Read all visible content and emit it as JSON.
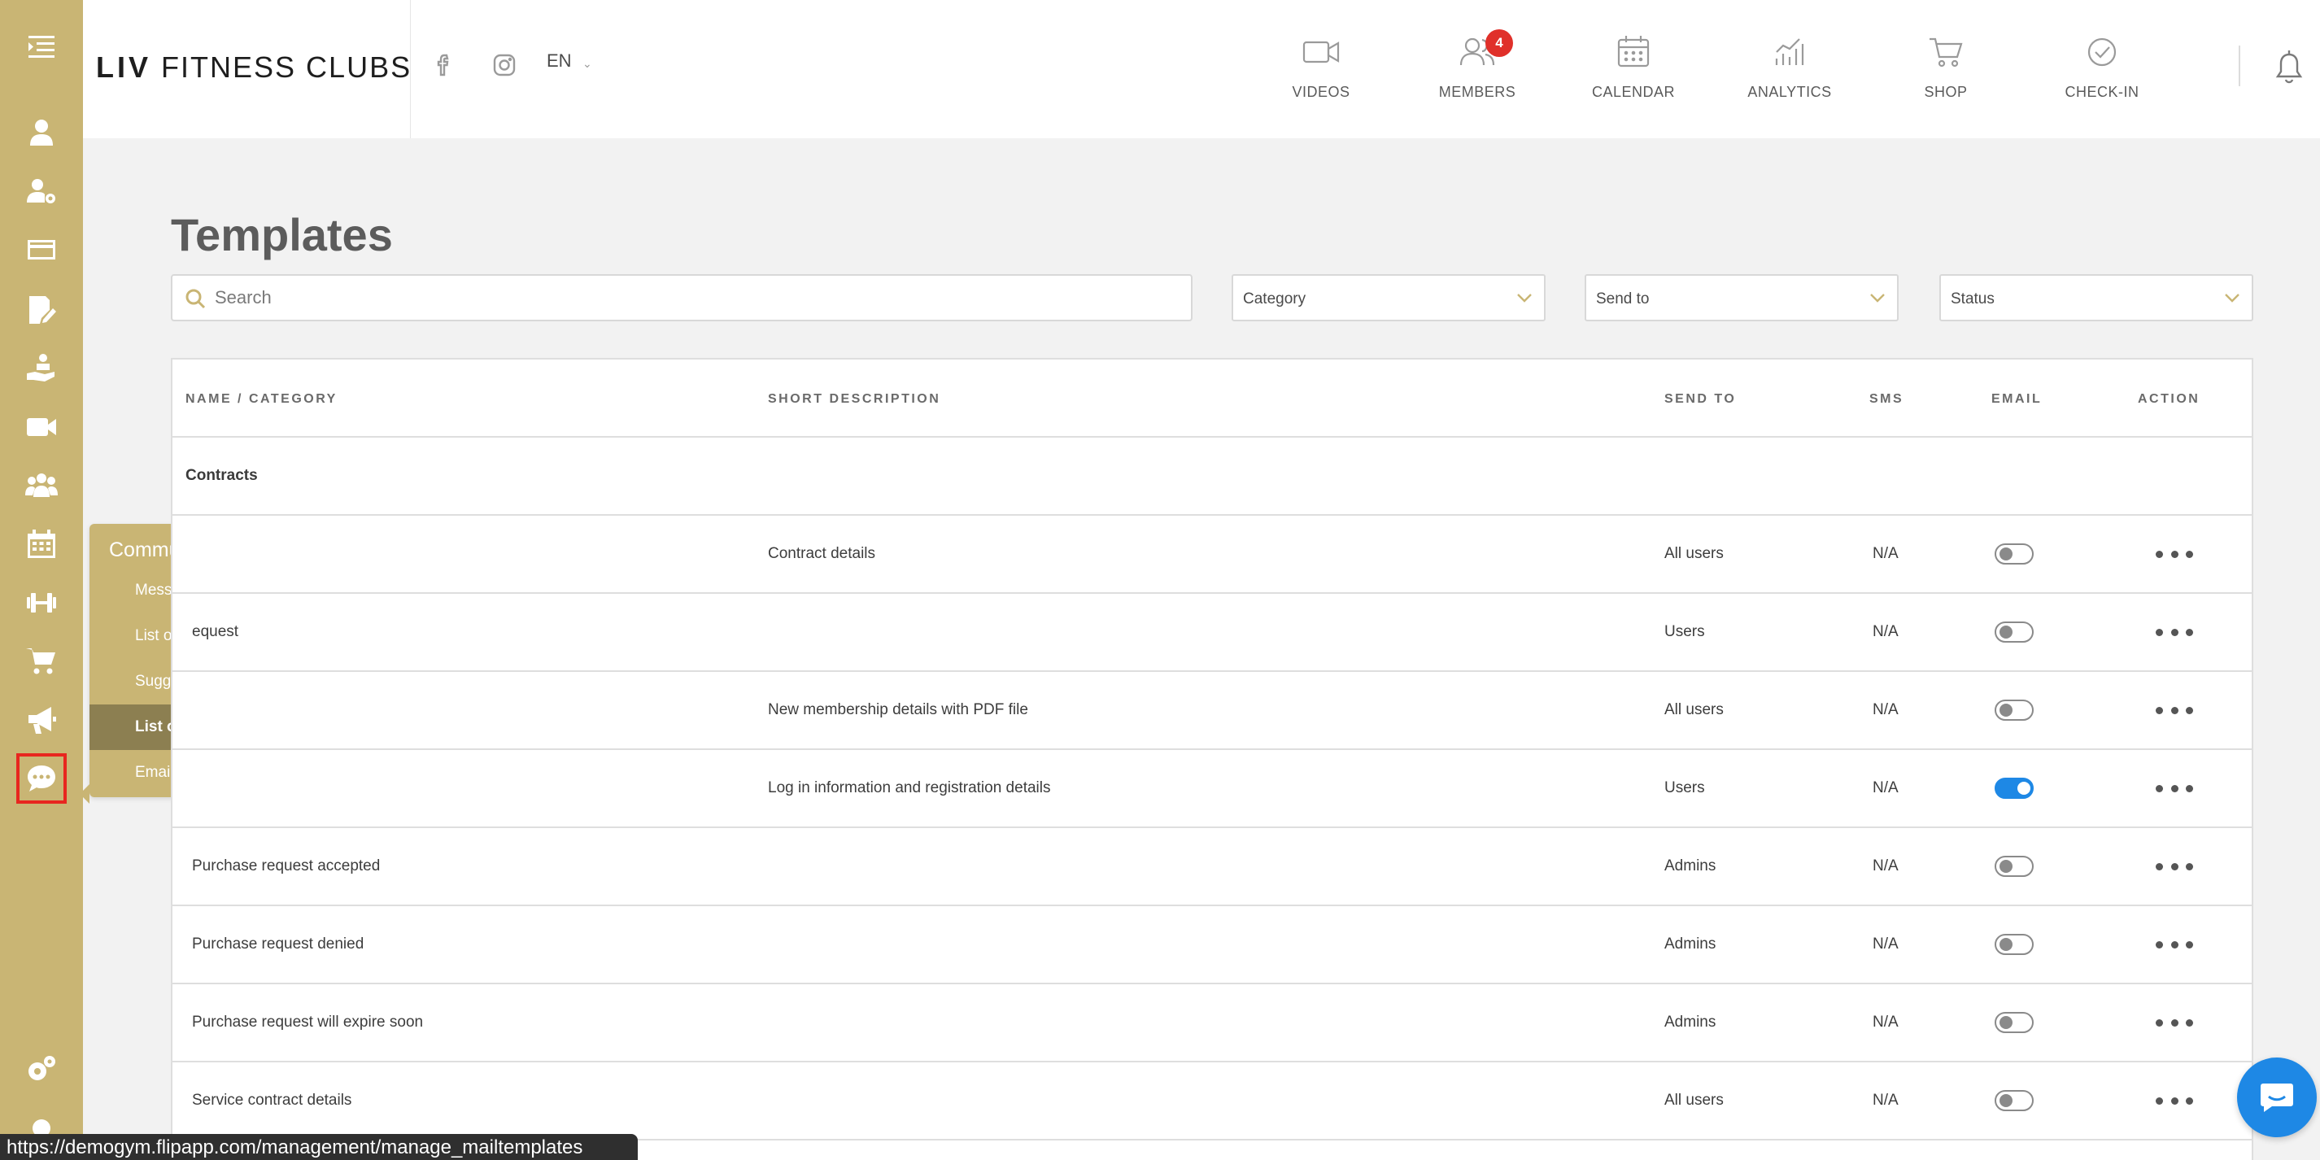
{
  "sidebar": {
    "icons": [
      "collapse-menu-icon",
      "user-icon",
      "user-settings-icon",
      "credit-card-icon",
      "document-edit-icon",
      "hand-service-icon",
      "video-icon",
      "group-icon",
      "calendar-icon",
      "dumbbell-icon",
      "cart-icon",
      "megaphone-icon",
      "chat-bubble-icon",
      "settings-icon"
    ],
    "active": "chat-bubble-icon"
  },
  "flyout": {
    "title": "Communications",
    "items": [
      "Messages",
      "List of quotes",
      "Suggestions",
      "List of templates",
      "Emails"
    ],
    "selected": "List of templates"
  },
  "header": {
    "logo_bold": "LIV",
    "logo_rest": "FITNESS CLUBS",
    "language": "EN",
    "nav": [
      {
        "label": "VIDEOS",
        "icon": "video-camera-icon"
      },
      {
        "label": "MEMBERS",
        "icon": "members-icon",
        "badge": "4"
      },
      {
        "label": "CALENDAR",
        "icon": "calendar-icon"
      },
      {
        "label": "ANALYTICS",
        "icon": "analytics-icon"
      },
      {
        "label": "SHOP",
        "icon": "shop-cart-icon"
      },
      {
        "label": "CHECK-IN",
        "icon": "check-circle-icon"
      }
    ]
  },
  "page": {
    "title": "Templates",
    "search_placeholder": "Search",
    "filters": {
      "category": "Category",
      "send_to": "Send to",
      "status": "Status"
    }
  },
  "table": {
    "headers": {
      "name": "NAME / CATEGORY",
      "description": "SHORT DESCRIPTION",
      "send_to": "SEND TO",
      "sms": "SMS",
      "email": "EMAIL",
      "action": "ACTION"
    },
    "group": "Contracts",
    "rows": [
      {
        "name": "",
        "description": "Contract details",
        "send_to": "All users",
        "sms": "N/A",
        "email_on": false
      },
      {
        "name": "equest",
        "description": "",
        "send_to": "Users",
        "sms": "N/A",
        "email_on": false
      },
      {
        "name": "",
        "description": "New membership details with PDF file",
        "send_to": "All users",
        "sms": "N/A",
        "email_on": false
      },
      {
        "name": "",
        "description": "Log in information and registration details",
        "send_to": "Users",
        "sms": "N/A",
        "email_on": true
      },
      {
        "name": "Purchase request accepted",
        "description": "",
        "send_to": "Admins",
        "sms": "N/A",
        "email_on": false
      },
      {
        "name": "Purchase request denied",
        "description": "",
        "send_to": "Admins",
        "sms": "N/A",
        "email_on": false
      },
      {
        "name": "Purchase request will expire soon",
        "description": "",
        "send_to": "Admins",
        "sms": "N/A",
        "email_on": false
      },
      {
        "name": "Service contract details",
        "description": "",
        "send_to": "All users",
        "sms": "N/A",
        "email_on": false
      }
    ]
  },
  "status_bar": {
    "url": "https://demogym.flipapp.com/management/manage_mailtemplates"
  },
  "colors": {
    "sidebar": "#c9b574",
    "flyout_selected": "#8c7f51",
    "toggle_on": "#1e88e5",
    "badge": "#e0302a",
    "active_outline": "#e8261f"
  }
}
